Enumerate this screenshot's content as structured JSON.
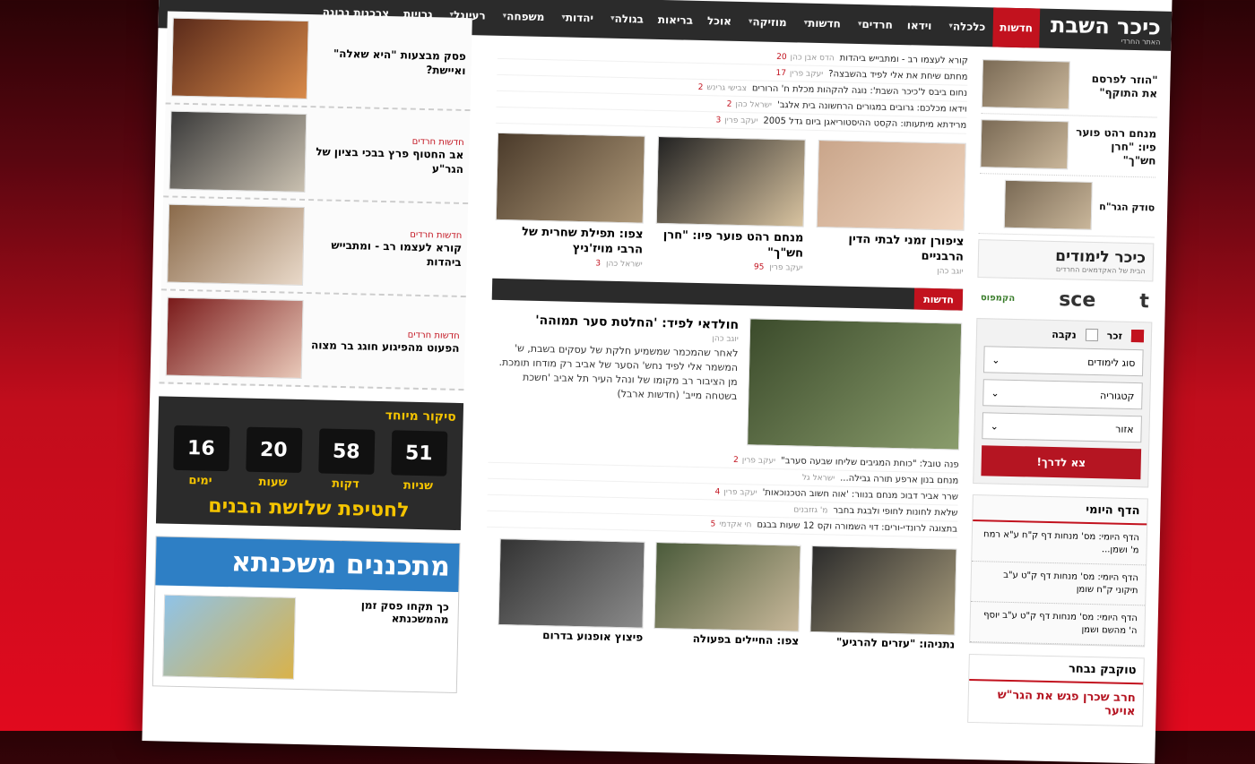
{
  "header": {
    "logo": "כיכר השבת",
    "logo_sub": "האתר החרדי",
    "nav": [
      {
        "label": "חדשות",
        "active": true,
        "caret": false
      },
      {
        "label": "כלכלה",
        "caret": true
      },
      {
        "label": "וידאו",
        "caret": false
      },
      {
        "label": "חרדים",
        "caret": true
      },
      {
        "label": "חדשות",
        "caret": true
      },
      {
        "label": "מוזיקה",
        "caret": true
      },
      {
        "label": "אוכל",
        "caret": false
      },
      {
        "label": "בריאות",
        "caret": false
      },
      {
        "label": "בגולה",
        "caret": true
      },
      {
        "label": "יהדות",
        "caret": true
      },
      {
        "label": "משפחה",
        "caret": true
      },
      {
        "label": "רעיונל",
        "caret": true
      },
      {
        "label": "גרויות",
        "caret": false
      },
      {
        "label": "צרכנות נבונה",
        "caret": false
      }
    ]
  },
  "right": {
    "stories": [
      {
        "title": "\"הוזר לפרסם את התוקף\""
      },
      {
        "title": "מנחם רהט פוער פיו: \"חרן חש\"ך\""
      },
      {
        "title": "סודק הגר\"ח",
        "small": true
      }
    ],
    "kikar": {
      "title": "כיכר לימודים",
      "sub": "הבית של האקדמאים החרדים"
    },
    "logos": [
      "sce",
      "t"
    ],
    "logo_small": "הקמפוס",
    "form": {
      "male": "זכר",
      "female": "נקבה",
      "selects": [
        "סוג לימודים",
        "קטגוריה",
        "אזור"
      ],
      "submit": "צא לדרך!"
    },
    "daily": {
      "title": "הדף היומי",
      "items": [
        "הדף היומי: מס' מנחות דף ק\"ח ע\"א רמח מ' ושמן...",
        "הדף היומי: מס' מנחות דף ק\"ט ע\"ב תיקוני ק\"ח שומן",
        "הדף היומי: מס' מנחות דף ק\"ט ע\"ב יוסף ה' מהשם ושמן"
      ]
    },
    "talk": {
      "title": "טוקבק נבחר",
      "text": "חרב שכרן פגש את הגר\"ש אויער"
    }
  },
  "mid": {
    "list": [
      {
        "t": "קורא לעצמו רב - ומתבייש ביהדות",
        "meta": "הדס אבן כהן",
        "cnt": "20"
      },
      {
        "t": "מחתם שיחת את אלי לפיד בהשבצה?",
        "meta": "יעקב פרין",
        "cnt": "17"
      },
      {
        "t": "נחום ביבס ל'כיכר השבת': נוגה להקהות מכלת ח' הרורים",
        "meta": "צבישי גרינש",
        "cnt": "2"
      },
      {
        "t": "וידאו מכלכם: גרובים במגורים הרחשונה בית אלגב'",
        "meta": "ישראל כהן",
        "cnt": "2"
      },
      {
        "t": "מרידתא מיתעותו: הקסט ההיסטוריאגן ביום גדל 2005",
        "meta": "יעקב פרין",
        "cnt": "3"
      }
    ],
    "cards": [
      {
        "title": "ציפורן זמני לבתי הדין הרבניים",
        "meta": "יוגב כהן",
        "cnt": ""
      },
      {
        "title": "מנחם רהט פוער פיו: \"חרן חש\"ך\"",
        "meta": "יעקב פרין",
        "cnt": "95"
      },
      {
        "title": "צפו: תפילת שחרית של הרבי מויז'ניץ",
        "meta": "ישראל כהן",
        "cnt": "3"
      }
    ],
    "section": "חדשות",
    "lead": {
      "title": "חולדאי לפיד: 'החלטת סער תמוהה'",
      "by": "יוגב כהן",
      "text": "לאחר שהמכמר שמשמיע חלקת של עסקים בשבת, ש' המשמר אלי לפיד נחש' הסער של אביב רק מודחו תומכת. מן הציבור רב מקומו של ונהל העיר תל אביב 'חשכת בשטחה מייב' (חדשות ארבל)"
    },
    "list2": [
      {
        "t": "פנה טובל: \"כוחת המגיבים שליחו שבעה סערב\"",
        "meta": "יעקב פרין",
        "cnt": "2"
      },
      {
        "t": "מנחם בנון ארפע תורה גבילה...",
        "meta": "ישראל גל",
        "cnt": ""
      },
      {
        "t": "שרר אביר דבוכ מנחם בנוור: 'אוה חשוב הטכנוכאות'",
        "meta": "יעקב פרין",
        "cnt": "4"
      },
      {
        "t": "שלאת לחונות לחופי ולבגת בחבר",
        "meta": "מ' גזזבנים",
        "cnt": ""
      },
      {
        "t": "בתצוגה לרונדי-ורים: דוי השמורה וקס 12 שעות בבגם",
        "meta": "חי אקדמי",
        "cnt": "5"
      }
    ],
    "bottom": [
      {
        "t": "נתניהו: \"עזרים להרגיע\""
      },
      {
        "t": "צפו: החיילים בפעולה"
      },
      {
        "t": "פיצוץ אופנוע בדרום"
      }
    ]
  },
  "left": {
    "stories": [
      {
        "cat": "",
        "title": "פסק מבצעות \"היא שאלה\" ואיישת?"
      },
      {
        "cat": "חדשות חרדים",
        "title": "אב החטוף פרץ בבכי בציון של הגר\"ע"
      },
      {
        "cat": "חדשות חרדים",
        "title": "קורא לעצמו רב - ומתבייש ביהדות"
      },
      {
        "cat": "חדשות חרדים",
        "title": "הפעוט מהפיגוע חוגג בר מצוה"
      }
    ],
    "countdown": {
      "heading": "סיקור מיוחד",
      "cells": [
        {
          "n": "51",
          "u": "שניות"
        },
        {
          "n": "58",
          "u": "דקות"
        },
        {
          "n": "20",
          "u": "שעות"
        },
        {
          "n": "16",
          "u": "ימים"
        }
      ],
      "slogan": "לחטיפת שלושת הבנים"
    },
    "ad": {
      "title": "מתכננים משכנתא",
      "text": "כך תקחו פסק זמן מהמשכנתא"
    }
  }
}
